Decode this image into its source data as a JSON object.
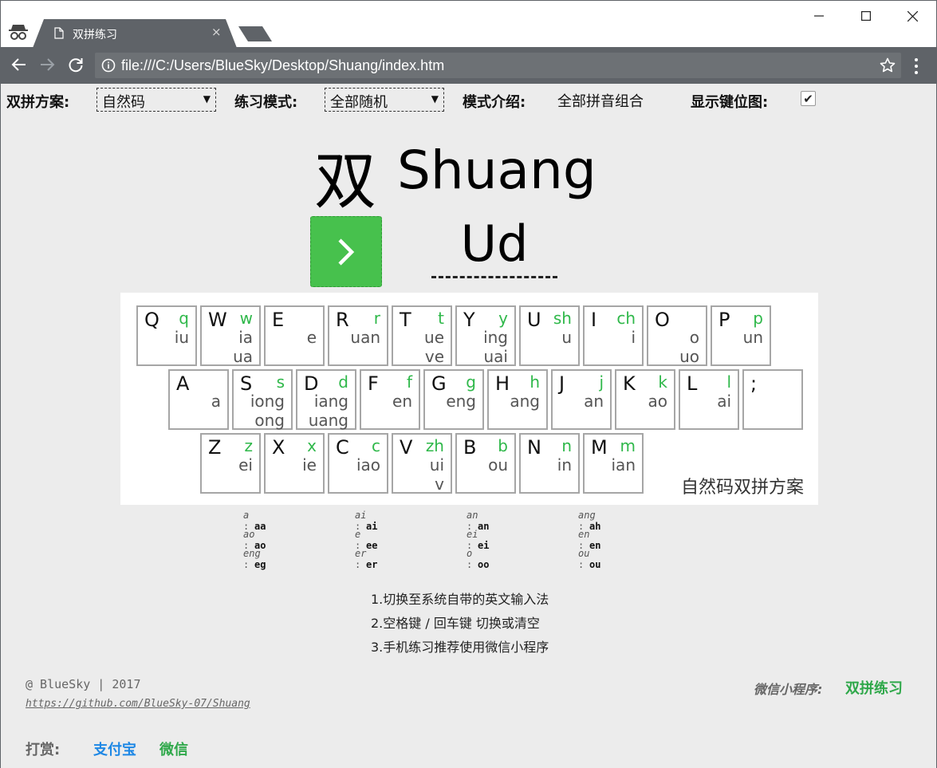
{
  "browser": {
    "tab_title": "双拼练习",
    "tab_close": "×",
    "url": "file:///C:/Users/BlueSky/Desktop/Shuang/index.htm",
    "window_controls": [
      "minimize",
      "maximize",
      "close"
    ]
  },
  "controls": {
    "scheme_label": "双拼方案:",
    "scheme_value": "自然码",
    "mode_label": "练习模式:",
    "mode_value": "全部随机",
    "mode_intro_label": "模式介绍:",
    "mode_intro_value": "全部拼音组合",
    "show_keymap_label": "显示键位图:",
    "show_keymap_checked": true,
    "dropdown_arrow": "▼",
    "checkmark": "✔"
  },
  "practice": {
    "hanzi": "双",
    "pinyin": "Shuang",
    "input_value": "Ud",
    "next_button": "next-arrow"
  },
  "keyboard": {
    "rows": [
      [
        {
          "key": "Q",
          "sm": "q",
          "ym": [
            "iu"
          ]
        },
        {
          "key": "W",
          "sm": "w",
          "ym": [
            "ia",
            "ua"
          ]
        },
        {
          "key": "E",
          "sm": "",
          "ym": [
            "e"
          ]
        },
        {
          "key": "R",
          "sm": "r",
          "ym": [
            "uan"
          ]
        },
        {
          "key": "T",
          "sm": "t",
          "ym": [
            "ue",
            "ve"
          ]
        },
        {
          "key": "Y",
          "sm": "y",
          "ym": [
            "ing",
            "uai"
          ]
        },
        {
          "key": "U",
          "sm": "sh",
          "ym": [
            "u"
          ]
        },
        {
          "key": "I",
          "sm": "ch",
          "ym": [
            "i"
          ]
        },
        {
          "key": "O",
          "sm": "",
          "ym": [
            "o",
            "uo"
          ]
        },
        {
          "key": "P",
          "sm": "p",
          "ym": [
            "un"
          ]
        }
      ],
      [
        {
          "key": "A",
          "sm": "",
          "ym": [
            "a"
          ]
        },
        {
          "key": "S",
          "sm": "s",
          "ym": [
            "iong",
            "ong"
          ]
        },
        {
          "key": "D",
          "sm": "d",
          "ym": [
            "iang",
            "uang"
          ]
        },
        {
          "key": "F",
          "sm": "f",
          "ym": [
            "en"
          ]
        },
        {
          "key": "G",
          "sm": "g",
          "ym": [
            "eng"
          ]
        },
        {
          "key": "H",
          "sm": "h",
          "ym": [
            "ang"
          ]
        },
        {
          "key": "J",
          "sm": "j",
          "ym": [
            "an"
          ]
        },
        {
          "key": "K",
          "sm": "k",
          "ym": [
            "ao"
          ]
        },
        {
          "key": "L",
          "sm": "l",
          "ym": [
            "ai"
          ]
        },
        {
          "key": ";",
          "sm": "",
          "ym": []
        }
      ],
      [
        {
          "key": "Z",
          "sm": "z",
          "ym": [
            "ei"
          ]
        },
        {
          "key": "X",
          "sm": "x",
          "ym": [
            "ie"
          ]
        },
        {
          "key": "C",
          "sm": "c",
          "ym": [
            "iao"
          ]
        },
        {
          "key": "V",
          "sm": "zh",
          "ym": [
            "ui",
            "v"
          ]
        },
        {
          "key": "B",
          "sm": "b",
          "ym": [
            "ou"
          ]
        },
        {
          "key": "N",
          "sm": "n",
          "ym": [
            "in"
          ]
        },
        {
          "key": "M",
          "sm": "m",
          "ym": [
            "ian"
          ]
        }
      ]
    ],
    "caption": "自然码双拼方案"
  },
  "zero_consonant": [
    [
      [
        "a",
        "aa"
      ],
      [
        "ai",
        "ai"
      ],
      [
        "an",
        "an"
      ],
      [
        "ang",
        "ah"
      ]
    ],
    [
      [
        "ao",
        "ao"
      ],
      [
        "e",
        "ee"
      ],
      [
        "ei",
        "ei"
      ],
      [
        "en",
        "en"
      ]
    ],
    [
      [
        "eng",
        "eg"
      ],
      [
        "er",
        "er"
      ],
      [
        "o",
        "oo"
      ],
      [
        "ou",
        "ou"
      ]
    ]
  ],
  "tips": [
    "1.切换至系统自带的英文输入法",
    "2.空格键 / 回车键 切换或清空",
    "3.手机练习推荐使用微信小程序"
  ],
  "footer": {
    "credit": "@ BlueSky | 2017",
    "github": "https://github.com/BlueSky-07/Shuang",
    "mini_program_label": "微信小程序:",
    "mini_program_name": "双拼练习",
    "reward_label": "打赏:",
    "alipay": "支付宝",
    "wechat": "微信"
  },
  "colors": {
    "accent_green": "#47c14d",
    "shengmu_green": "#2fb84a",
    "alipay_blue": "#1e88e5",
    "chrome_gray": "#5f6368",
    "page_bg": "#ececec"
  }
}
